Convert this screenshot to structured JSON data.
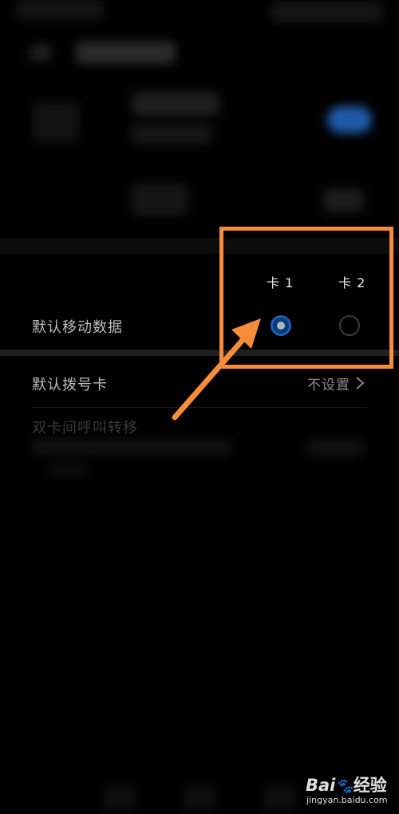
{
  "dual_sim": {
    "card_headers": [
      "卡 1",
      "卡 2"
    ],
    "default_mobile_data": {
      "label": "默认移动数据",
      "selected_card": 1
    },
    "default_dial_card": {
      "label": "默认拨号卡",
      "value": "不设置"
    },
    "call_forwarding": {
      "label": "双卡间呼叫转移"
    }
  },
  "watermark": {
    "brand": "Bai",
    "brand_suffix": "经验",
    "url": "jingyan.baidu.com"
  },
  "colors": {
    "background": "#000000",
    "radio_selected": "#1d5fb8",
    "annotation": "#f78c3a"
  }
}
